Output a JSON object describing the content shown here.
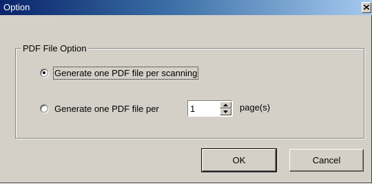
{
  "window": {
    "title": "Option"
  },
  "group": {
    "label": "PDF File Option"
  },
  "options": {
    "per_scan_label": "Generate one PDF file per scanning",
    "per_scan_checked": true,
    "per_pages_label": "Generate one PDF file per",
    "per_pages_checked": false,
    "pages_value": "1",
    "pages_suffix": "page(s)"
  },
  "buttons": {
    "ok": "OK",
    "cancel": "Cancel"
  },
  "colors": {
    "face": "#d4d0c8",
    "title_start": "#0a246a",
    "title_end": "#a6caf0"
  },
  "icons": {
    "close": "close-icon",
    "spin_up": "arrow-up-icon",
    "spin_down": "arrow-down-icon"
  }
}
